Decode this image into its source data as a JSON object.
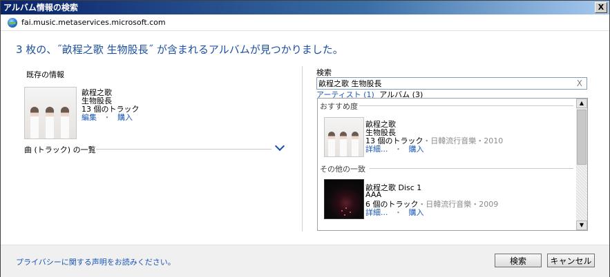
{
  "window": {
    "title": "アルバム情報の検索",
    "close_label": "X"
  },
  "address": {
    "url": "fai.music.metaservices.microsoft.com"
  },
  "heading": "3 枚の、˝畝程之歌 生物股長˝ が含まれるアルバムが見つかりました。",
  "existing": {
    "section_label": "既存の情報",
    "album_title": "畝程之歌",
    "artist": "生物股長",
    "tracks": "13 個のトラック",
    "edit_link": "編集",
    "sep": "・",
    "buy_link": "購入",
    "track_list_label": "曲 (トラック) の一覧"
  },
  "search": {
    "label": "検索",
    "value": "畝程之歌 生物股長",
    "clear_label": "X",
    "tab_artist": "アーティスト (1)",
    "tab_album": "アルバム (3)"
  },
  "results": {
    "recommended_label": "おすすめ度",
    "other_label": "その他の一致",
    "items": [
      {
        "title": "畝程之歌",
        "artist": "生物股長",
        "tracks": "13 個のトラック",
        "meta": "・日韓流行音樂・2010",
        "details": "詳細...",
        "sep": "・",
        "buy": "購入"
      },
      {
        "title": "畝程之歌 Disc 1",
        "artist": "AAA",
        "tracks": "6 個のトラック",
        "meta": "・日韓流行音樂・2009",
        "details": "詳細...",
        "sep": "・",
        "buy": "購入"
      }
    ]
  },
  "footer": {
    "privacy_link": "プライバシーに関する声明をお読みください。",
    "search_button": "検索",
    "cancel_button": "キャンセル"
  },
  "colors": {
    "accent": "#1a56b8",
    "heading": "#1a4fa0",
    "titlebar": "#0a246a"
  }
}
